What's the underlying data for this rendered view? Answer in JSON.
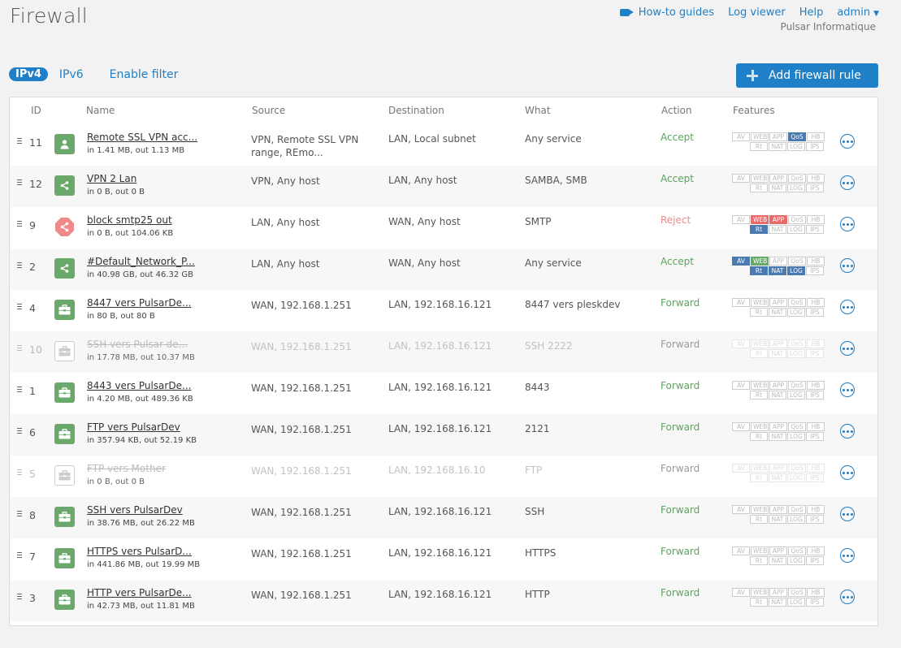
{
  "header": {
    "title": "Firewall",
    "nav": {
      "guides": "How-to guides",
      "log_viewer": "Log viewer",
      "help": "Help",
      "user": "admin"
    },
    "organization": "Pulsar Informatique"
  },
  "subnav": {
    "ipv4": "IPv4",
    "ipv6": "IPv6",
    "filter": "Enable filter"
  },
  "add_button": "Add firewall rule",
  "columns": {
    "id": "ID",
    "name": "Name",
    "source": "Source",
    "destination": "Destination",
    "what": "What",
    "action": "Action",
    "features": "Features"
  },
  "feature_labels": {
    "av": "AV",
    "web": "WEB",
    "app": "APP",
    "qos": "QoS",
    "hb": "HB",
    "rt": "Rt",
    "nat": "NAT",
    "log": "LOG",
    "ips": "IPS"
  },
  "colors": {
    "accent": "#1f7fc7",
    "accept": "#5ca35d",
    "reject": "#e98a8a",
    "feature_blue": "#4a7ab0",
    "feature_green": "#6aa96b",
    "feature_red": "#e86b6b"
  },
  "rows": [
    {
      "id": "11",
      "icon": "user-icon",
      "name": "Remote SSL VPN acc...",
      "traffic": "in 1.41 MB, out 1.13 MB",
      "source": "VPN, Remote SSL VPN range, REmo...",
      "destination": "LAN, Local subnet",
      "what": "Any service",
      "action": "Accept",
      "action_type": "accept",
      "disabled": false,
      "features": {
        "qos": "blue"
      }
    },
    {
      "id": "12",
      "icon": "share-icon",
      "name": "VPN 2 Lan",
      "traffic": "in 0 B, out 0 B",
      "source": "VPN, Any host",
      "destination": "LAN, Any host",
      "what": "SAMBA, SMB",
      "action": "Accept",
      "action_type": "accept",
      "disabled": false,
      "features": {}
    },
    {
      "id": "9",
      "icon": "reject-share-icon",
      "name": "block smtp25 out",
      "traffic": "in 0 B, out 104.06 KB",
      "source": "LAN, Any host",
      "destination": "WAN, Any host",
      "what": "SMTP",
      "action": "Reject",
      "action_type": "reject",
      "disabled": false,
      "features": {
        "web": "red",
        "app": "red",
        "rt": "blue"
      }
    },
    {
      "id": "2",
      "icon": "share-icon",
      "name": "#Default_Network_P...",
      "traffic": "in 40.98 GB, out 46.32 GB",
      "source": "LAN, Any host",
      "destination": "WAN, Any host",
      "what": "Any service",
      "action": "Accept",
      "action_type": "accept",
      "disabled": false,
      "features": {
        "av": "blue",
        "web": "green",
        "rt": "blue",
        "nat": "blue",
        "log": "blue"
      }
    },
    {
      "id": "4",
      "icon": "briefcase-icon",
      "name": "8447 vers PulsarDe...",
      "traffic": "in 80 B, out 80 B",
      "source": "WAN, 192.168.1.251",
      "destination": "LAN, 192.168.16.121",
      "what": "8447 vers pleskdev",
      "action": "Forward",
      "action_type": "forward",
      "disabled": false,
      "features": {}
    },
    {
      "id": "10",
      "icon": "briefcase-icon",
      "name": "SSH vers Pulsar-de...",
      "traffic": "in 17.78 MB, out 10.37 MB",
      "source": "WAN, 192.168.1.251",
      "destination": "LAN, 192.168.16.121",
      "what": "SSH 2222",
      "action": "Forward",
      "action_type": "forward",
      "disabled": true,
      "features": {}
    },
    {
      "id": "1",
      "icon": "briefcase-icon",
      "name": "8443 vers PulsarDe...",
      "traffic": "in 4.20 MB, out 489.36 KB",
      "source": "WAN, 192.168.1.251",
      "destination": "LAN, 192.168.16.121",
      "what": "8443",
      "action": "Forward",
      "action_type": "forward",
      "disabled": false,
      "features": {}
    },
    {
      "id": "6",
      "icon": "briefcase-icon",
      "name": "FTP vers PulsarDev",
      "traffic": "in 357.94 KB, out 52.19 KB",
      "source": "WAN, 192.168.1.251",
      "destination": "LAN, 192.168.16.121",
      "what": "2121",
      "action": "Forward",
      "action_type": "forward",
      "disabled": false,
      "features": {}
    },
    {
      "id": "5",
      "icon": "briefcase-icon",
      "name": "FTP vers Mother",
      "traffic": "in 0 B, out 0 B",
      "source": "WAN, 192.168.1.251",
      "destination": "LAN, 192.168.16.10",
      "what": "FTP",
      "action": "Forward",
      "action_type": "forward",
      "disabled": true,
      "features": {}
    },
    {
      "id": "8",
      "icon": "briefcase-icon",
      "name": "SSH vers PulsarDev",
      "traffic": "in 38.76 MB, out 26.22 MB",
      "source": "WAN, 192.168.1.251",
      "destination": "LAN, 192.168.16.121",
      "what": "SSH",
      "action": "Forward",
      "action_type": "forward",
      "disabled": false,
      "features": {}
    },
    {
      "id": "7",
      "icon": "briefcase-icon",
      "name": "HTTPS vers PulsarD...",
      "traffic": "in 441.86 MB, out 19.99 MB",
      "source": "WAN, 192.168.1.251",
      "destination": "LAN, 192.168.16.121",
      "what": "HTTPS",
      "action": "Forward",
      "action_type": "forward",
      "disabled": false,
      "features": {}
    },
    {
      "id": "3",
      "icon": "briefcase-icon",
      "name": "HTTP vers PulsarDe...",
      "traffic": "in 42.73 MB, out 11.81 MB",
      "source": "WAN, 192.168.1.251",
      "destination": "LAN, 192.168.16.121",
      "what": "HTTP",
      "action": "Forward",
      "action_type": "forward",
      "disabled": false,
      "features": {}
    }
  ]
}
